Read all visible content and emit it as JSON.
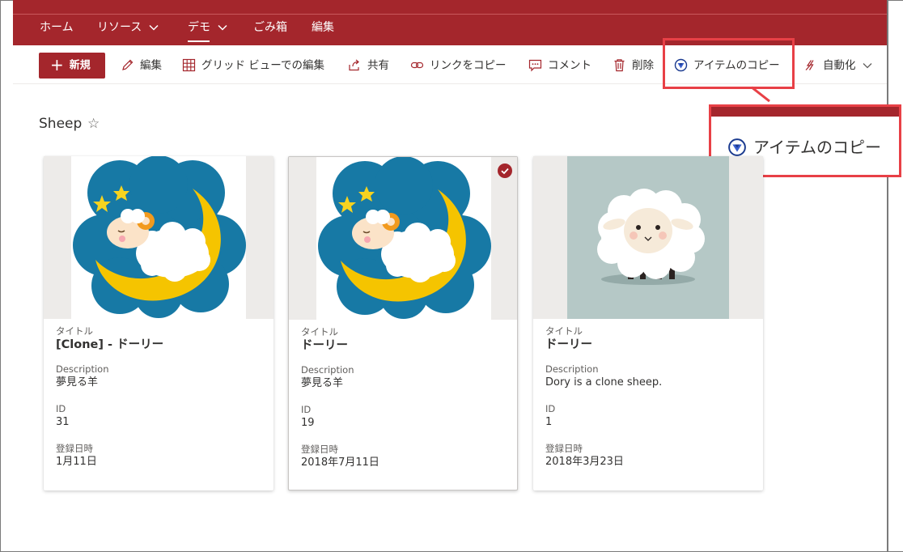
{
  "nav": {
    "items": [
      {
        "label": "ホーム",
        "has_menu": false,
        "active": false
      },
      {
        "label": "リソース",
        "has_menu": true,
        "active": false
      },
      {
        "label": "デモ",
        "has_menu": true,
        "active": true
      },
      {
        "label": "ごみ箱",
        "has_menu": false,
        "active": false
      },
      {
        "label": "編集",
        "has_menu": false,
        "active": false
      }
    ]
  },
  "toolbar": {
    "new_label": "新規",
    "edit_label": "編集",
    "grid_edit_label": "グリッド ビューでの編集",
    "share_label": "共有",
    "copy_link_label": "リンクをコピー",
    "comment_label": "コメント",
    "delete_label": "削除",
    "copy_item_label": "アイテムのコピー",
    "automate_label": "自動化"
  },
  "callout": {
    "label": "アイテムのコピー"
  },
  "page": {
    "title": "Sheep",
    "favorite_icon": "star-outline-icon"
  },
  "cards": [
    {
      "selected": false,
      "image": "sleeping-sheep-on-moon",
      "fields": [
        {
          "label": "タイトル",
          "value": "[Clone] - ドーリー"
        },
        {
          "label": "Description",
          "value": "夢見る羊"
        },
        {
          "label": "ID",
          "value": "31"
        },
        {
          "label": "登録日時",
          "value": "1月11日"
        }
      ]
    },
    {
      "selected": true,
      "image": "sleeping-sheep-on-moon",
      "fields": [
        {
          "label": "タイトル",
          "value": "ドーリー"
        },
        {
          "label": "Description",
          "value": "夢見る羊"
        },
        {
          "label": "ID",
          "value": "19"
        },
        {
          "label": "登録日時",
          "value": "2018年7月11日"
        }
      ]
    },
    {
      "selected": false,
      "image": "standing-sheep",
      "fields": [
        {
          "label": "タイトル",
          "value": "ドーリー"
        },
        {
          "label": "Description",
          "value": "Dory is a clone sheep."
        },
        {
          "label": "ID",
          "value": "1"
        },
        {
          "label": "登録日時",
          "value": "2018年3月23日"
        }
      ]
    }
  ],
  "colors": {
    "brand": "#a4262c",
    "highlight": "#e84046"
  }
}
